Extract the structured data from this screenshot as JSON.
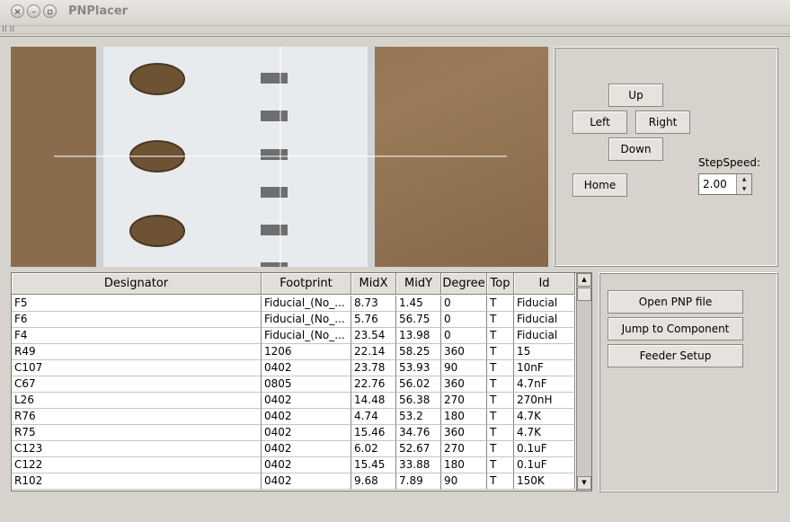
{
  "window": {
    "title": "PNPlacer"
  },
  "controls": {
    "up": "Up",
    "left": "Left",
    "right": "Right",
    "down": "Down",
    "home": "Home",
    "step_speed_label": "StepSpeed:",
    "step_speed_value": "2.00"
  },
  "actions": {
    "open": "Open PNP file",
    "jump": "Jump to Component",
    "feeder": "Feeder Setup"
  },
  "table": {
    "columns": [
      "Designator",
      "Footprint",
      "MidX",
      "MidY",
      "Degree",
      "Top",
      "Id"
    ],
    "rows": [
      [
        "F5",
        "Fiducial_(No_...",
        "8.73",
        "1.45",
        "0",
        "T",
        "Fiducial"
      ],
      [
        "F6",
        "Fiducial_(No_...",
        "5.76",
        "56.75",
        "0",
        "T",
        "Fiducial"
      ],
      [
        "F4",
        "Fiducial_(No_...",
        "23.54",
        "13.98",
        "0",
        "T",
        "Fiducial"
      ],
      [
        "R49",
        "1206",
        "22.14",
        "58.25",
        "360",
        "T",
        "15"
      ],
      [
        "C107",
        "0402",
        "23.78",
        "53.93",
        "90",
        "T",
        "10nF"
      ],
      [
        "C67",
        "0805",
        "22.76",
        "56.02",
        "360",
        "T",
        "4.7nF"
      ],
      [
        "L26",
        "0402",
        "14.48",
        "56.38",
        "270",
        "T",
        "270nH"
      ],
      [
        "R76",
        "0402",
        "4.74",
        "53.2",
        "180",
        "T",
        "4.7K"
      ],
      [
        "R75",
        "0402",
        "15.46",
        "34.76",
        "360",
        "T",
        "4.7K"
      ],
      [
        "C123",
        "0402",
        "6.02",
        "52.67",
        "270",
        "T",
        "0.1uF"
      ],
      [
        "C122",
        "0402",
        "15.45",
        "33.88",
        "180",
        "T",
        "0.1uF"
      ],
      [
        "R102",
        "0402",
        "9.68",
        "7.89",
        "90",
        "T",
        "150K"
      ]
    ]
  }
}
